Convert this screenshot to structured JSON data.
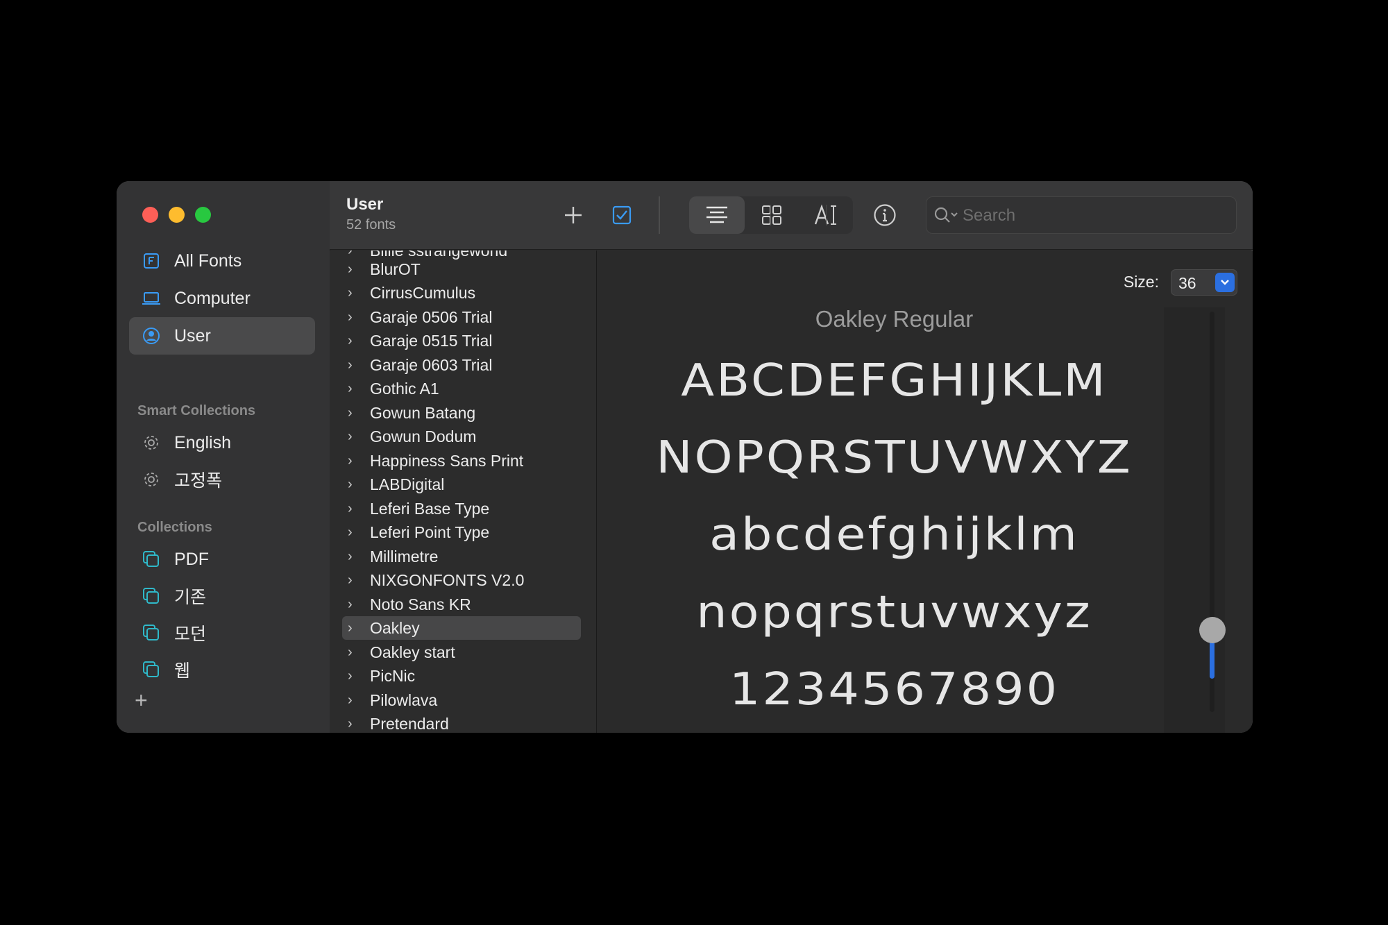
{
  "sidebar": {
    "items": [
      {
        "label": "All Fonts",
        "icon": "font-book-icon"
      },
      {
        "label": "Computer",
        "icon": "laptop-icon"
      },
      {
        "label": "User",
        "icon": "user-icon",
        "selected": true
      }
    ],
    "smart_heading": "Smart Collections",
    "smart": [
      {
        "label": "English",
        "icon": "gear-icon"
      },
      {
        "label": "고정폭",
        "icon": "gear-icon"
      }
    ],
    "collections_heading": "Collections",
    "collections": [
      {
        "label": "PDF",
        "icon": "collection-icon"
      },
      {
        "label": "기존",
        "icon": "collection-icon"
      },
      {
        "label": "모던",
        "icon": "collection-icon"
      },
      {
        "label": "웹",
        "icon": "collection-icon"
      }
    ],
    "add_label": "+"
  },
  "toolbar": {
    "title": "User",
    "subtitle": "52 fonts",
    "search_placeholder": "Search"
  },
  "font_list": [
    "Billie sstrangeworld",
    "BlurOT",
    "CirrusCumulus",
    "Garaje 0506 Trial",
    "Garaje 0515 Trial",
    "Garaje 0603 Trial",
    "Gothic A1",
    "Gowun Batang",
    "Gowun Dodum",
    "Happiness Sans Print",
    "LABDigital",
    "Leferi Base Type",
    "Leferi Point Type",
    "Millimetre",
    "NIXGONFONTS V2.0",
    "Noto Sans KR",
    "Oakley",
    "Oakley start",
    "PicNic",
    "Pilowlava",
    "Pretendard"
  ],
  "selected_font": "Oakley",
  "preview": {
    "size_label": "Size:",
    "size_value": "36",
    "font_name": "Oakley Regular",
    "lines": [
      "ABCDEFGHIJKLM",
      "NOPQRSTUVWXYZ",
      "abcdefghijklm",
      "nopqrstuvwxyz",
      "1234567890"
    ],
    "size_slider_level": 0.1
  },
  "colors": {
    "accent": "#2b6fe0",
    "window_bg": "#2b2b2b",
    "sidebar_bg": "#333334"
  }
}
